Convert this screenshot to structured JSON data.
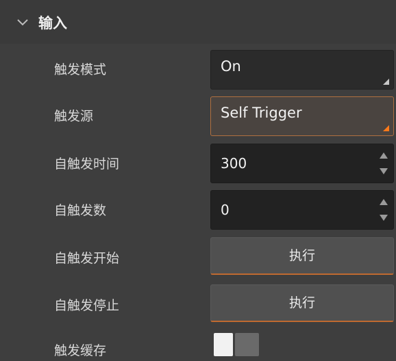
{
  "section": {
    "title": "输入",
    "icon": "chevron-down-icon"
  },
  "fields": {
    "trigger_mode": {
      "label": "触发模式",
      "value": "On"
    },
    "trigger_source": {
      "label": "触发源",
      "value": "Self Trigger"
    },
    "self_trigger_time": {
      "label": "自触发时间",
      "value": "300"
    },
    "self_trigger_count": {
      "label": "自触发数",
      "value": "0"
    },
    "self_trigger_start": {
      "label": "自触发开始",
      "button": "执行"
    },
    "self_trigger_stop": {
      "label": "自触发停止",
      "button": "执行"
    },
    "trigger_cache": {
      "label": "触发缓存",
      "enabled": false
    }
  },
  "colors": {
    "accent": "#ff7a1a",
    "background": "#3e3e3e"
  }
}
